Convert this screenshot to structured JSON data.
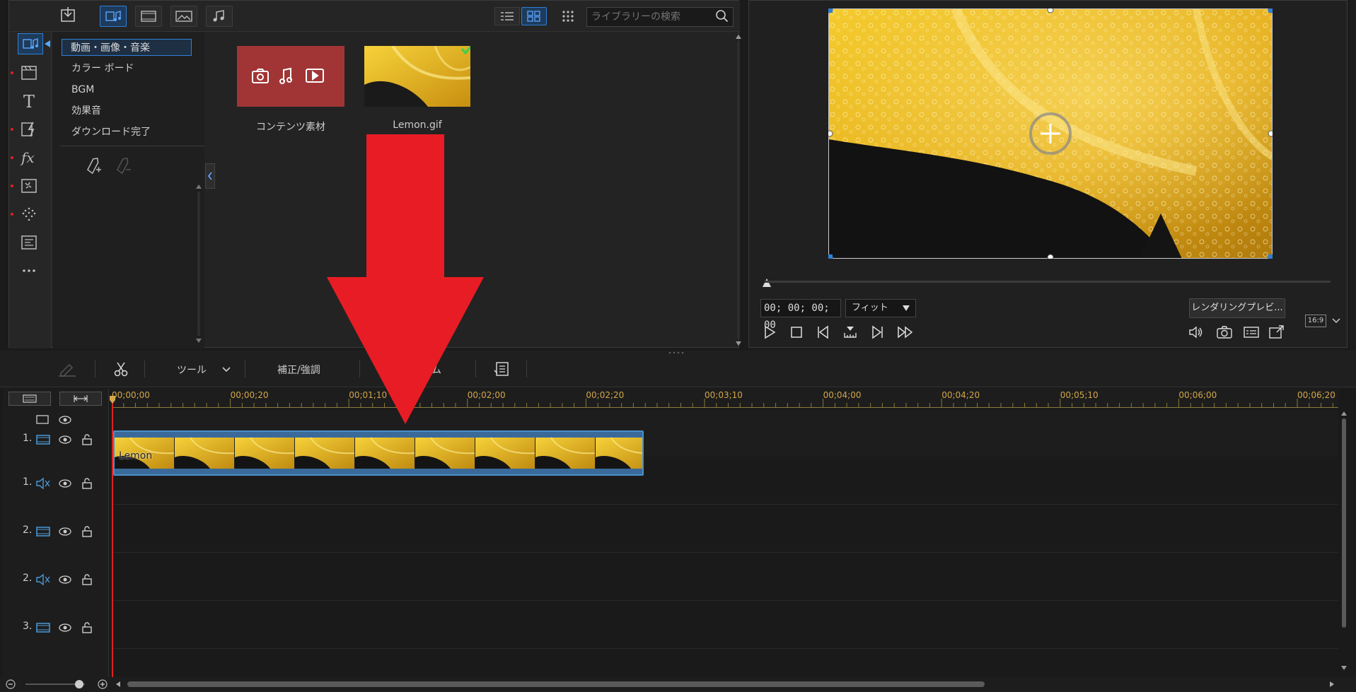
{
  "library": {
    "search_placeholder": "ライブラリーの検索",
    "categories": [
      "動画・画像・音楽",
      "カラー ボード",
      "BGM",
      "効果音",
      "ダウンロード完了"
    ],
    "tiles": [
      {
        "label": "コンテンツ素材"
      },
      {
        "label": "Lemon.gif"
      }
    ]
  },
  "preview": {
    "timecode": "00; 00; 00; 00",
    "fit_label": "フィット",
    "render_label": "レンダリングプレビ...",
    "aspect": "16:9"
  },
  "edit_toolbar": {
    "tools_label": "ツール",
    "fix_label": "補正/強調",
    "hidden_label": "ム"
  },
  "timeline": {
    "ticks": [
      "00;00;00",
      "00;00;20",
      "00;01;10",
      "00;02;00",
      "00;02;20",
      "00;03;10",
      "00;04;00",
      "00;04;20",
      "00;05;10",
      "00;06;00",
      "00;06;20"
    ],
    "tracks": [
      {
        "num": "1.",
        "type": "video"
      },
      {
        "num": "1.",
        "type": "audio"
      },
      {
        "num": "2.",
        "type": "video"
      },
      {
        "num": "2.",
        "type": "audio"
      },
      {
        "num": "3.",
        "type": "video"
      }
    ],
    "clip_label": "Lemon"
  },
  "colors": {
    "accent": "#2f7fd6",
    "arrow": "#e81c24",
    "content_tile": "#a13535",
    "tick": "#d3a74a"
  }
}
